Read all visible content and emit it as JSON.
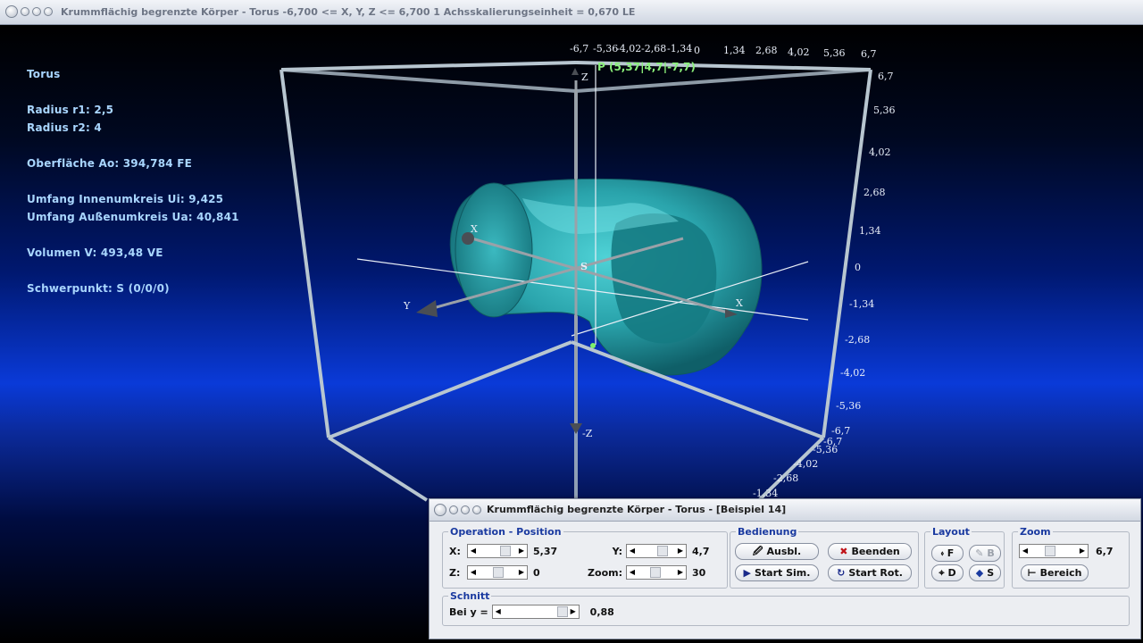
{
  "window": {
    "title": "Krummflächig begrenzte Körper - Torus    -6,700 <= X, Y, Z <= 6,700    1 Achsskalierungseinheit = 0,670 LE"
  },
  "info": {
    "heading": "Torus",
    "radius_r1": "Radius r1: 2,5",
    "radius_r2": "Radius r2: 4",
    "surface": "Oberfläche Ao: 394,784 FE",
    "inner_circumference": "Umfang Innenumkreis Ui: 9,425",
    "outer_circumference": "Umfang Außenumkreis Ua: 40,841",
    "volume": "Volumen V: 493,48 VE",
    "centroid": "Schwerpunkt: S (0/0/0)"
  },
  "scene": {
    "top_ticks": [
      "-6,7",
      "-5,36",
      "-4,02",
      "-2,68",
      "-1,34",
      "0",
      "1,34",
      "2,68",
      "4,02",
      "5,36",
      "6,7"
    ],
    "right_ticks": [
      "6,7",
      "5,36",
      "4,02",
      "2,68",
      "1,34",
      "0",
      "-1,34",
      "-2,68",
      "-4,02",
      "-5,36",
      "-6,7"
    ],
    "bottom_ticks": [
      "-6,7",
      "-5,36",
      "-4,02",
      "-2,68",
      "-1,34"
    ],
    "axis_z": "Z",
    "axis_neg_z": "-Z",
    "axis_x_left": "X",
    "axis_x_right": "X",
    "axis_y": "Y",
    "origin": "S",
    "point": "P (5,37|4,7|-7,7)"
  },
  "control": {
    "title": "Krummflächig begrenzte Körper - Torus - [Beispiel 14]",
    "group_operation": "Operation - Position",
    "x_label": "X:",
    "x_value": "5,37",
    "y_label": "Y:",
    "y_value": "4,7",
    "z_label": "Z:",
    "z_value": "0",
    "zoom_label": "Zoom:",
    "zoom_value": "30",
    "group_bedienung": "Bedienung",
    "btn_ausbl": "Ausbl.",
    "btn_beenden": "Beenden",
    "btn_start_sim": "Start Sim.",
    "btn_start_rot": "Start Rot.",
    "group_layout": "Layout",
    "btn_f": "F",
    "btn_b": "B",
    "btn_d": "D",
    "btn_s": "S",
    "group_zoom": "Zoom",
    "zoom2_value": "6,7",
    "btn_bereich": "Bereich",
    "group_schnitt": "Schnitt",
    "bei_y_label": "Bei y =",
    "bei_y_value": "0,88"
  }
}
